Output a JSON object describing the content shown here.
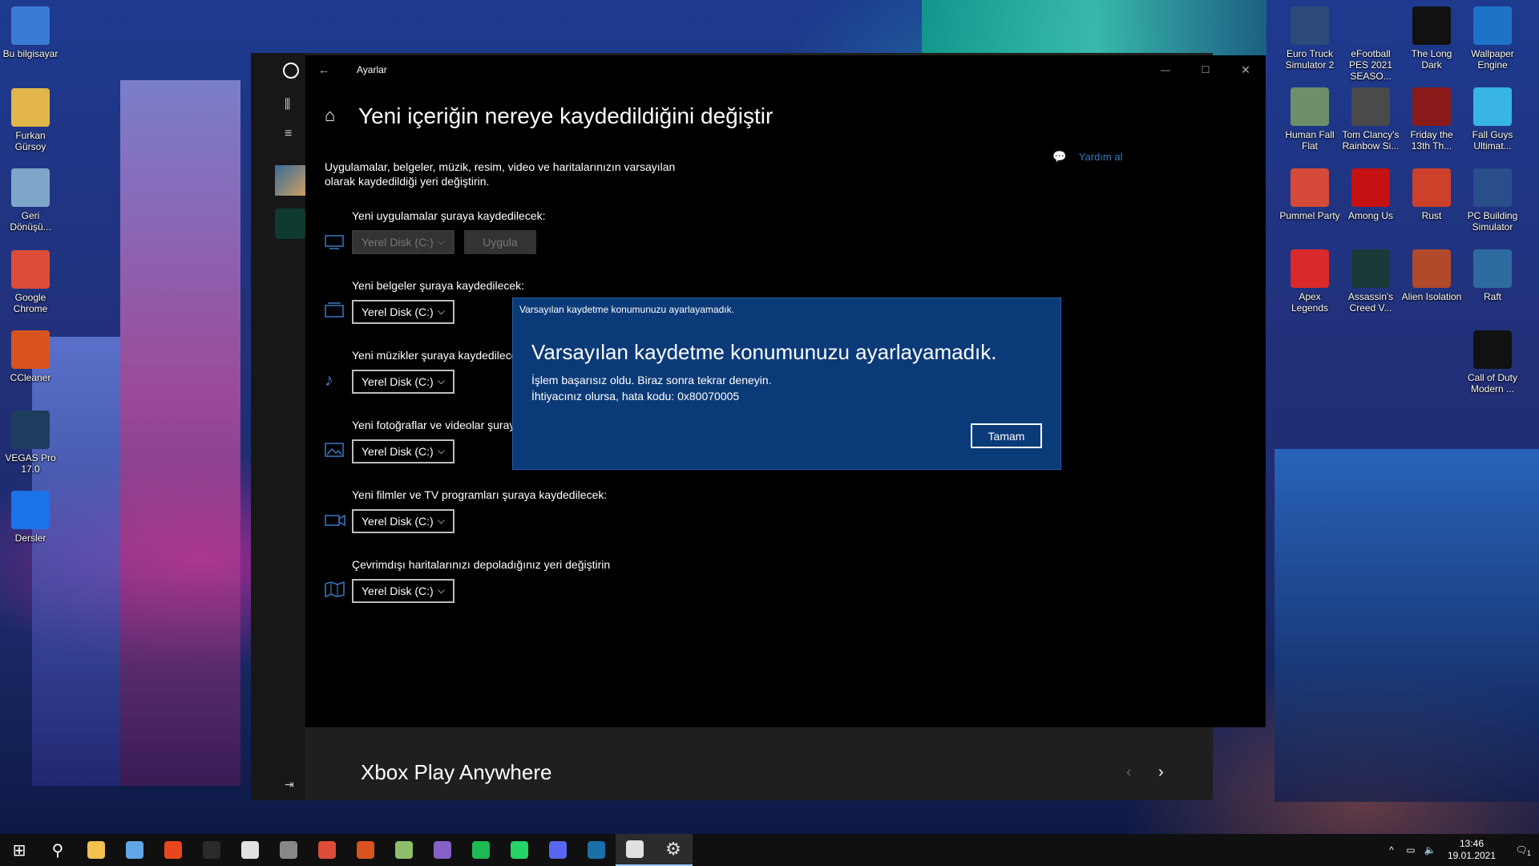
{
  "desktop": {
    "left_icons": [
      {
        "label": "Bu bilgisayar",
        "color": "#3a7bd5"
      },
      {
        "label": "Furkan Gürsoy",
        "color": "#e2b64a"
      },
      {
        "label": "Geri Dönüşü...",
        "color": "#7fa6c8"
      },
      {
        "label": "Google Chrome",
        "color": "#dd4b39"
      },
      {
        "label": "CCleaner",
        "color": "#d9531e"
      },
      {
        "label": "VEGAS Pro 17.0",
        "color": "#1d3d5e"
      },
      {
        "label": "Dersler",
        "color": "#1a73e8"
      }
    ],
    "right_icons": [
      {
        "label": "Euro Truck Simulator 2",
        "color": "#2b4a7a"
      },
      {
        "label": "eFootball PES 2021 SEASO...",
        "color": "#1e3c8a"
      },
      {
        "label": "The Long Dark",
        "color": "#111111"
      },
      {
        "label": "Wallpaper Engine",
        "color": "#1e73c8"
      },
      {
        "label": "Human Fall Flat",
        "color": "#6d8f6a"
      },
      {
        "label": "Tom Clancy's Rainbow Si...",
        "color": "#4a4a4a"
      },
      {
        "label": "Friday the 13th Th...",
        "color": "#8a1a1a"
      },
      {
        "label": "Fall Guys Ultimat...",
        "color": "#39b4e6"
      },
      {
        "label": "Pummel Party",
        "color": "#d64a3a"
      },
      {
        "label": "Among Us",
        "color": "#c51111"
      },
      {
        "label": "Rust",
        "color": "#cd412b"
      },
      {
        "label": "PC Building Simulator",
        "color": "#2a4e8a"
      },
      {
        "label": "Apex Legends",
        "color": "#da292a"
      },
      {
        "label": "Assassin's Creed V...",
        "color": "#1a3a3a"
      },
      {
        "label": "Alien Isolation",
        "color": "#b04a2a"
      },
      {
        "label": "Raft",
        "color": "#2d6aa0"
      },
      {
        "label": "Call of Duty Modern ...",
        "color": "#111111"
      }
    ]
  },
  "xbox_app": {
    "section_title": "Xbox Play Anywhere",
    "nav_icons": [
      "xbox-logo-icon",
      "library-icon",
      "menu-icon",
      "collapse-icon"
    ]
  },
  "settings": {
    "window_title": "Ayarlar",
    "page_title": "Yeni içeriğin nereye kaydedildiğini değiştir",
    "description": "Uygulamalar, belgeler, müzik, resim, video ve haritalarınızın varsayılan olarak kaydedildiği yeri değiştirin.",
    "help_label": "Yardım al",
    "apply_label": "Uygula",
    "sections": [
      {
        "label": "Yeni uygulamalar şuraya kaydedilecek:",
        "value": "Yerel Disk (C:)",
        "icon": "monitor-icon"
      },
      {
        "label": "Yeni belgeler şuraya kaydedilecek:",
        "value": "Yerel Disk (C:)",
        "icon": "documents-icon"
      },
      {
        "label": "Yeni müzikler şuraya kaydedilecek:",
        "value": "Yerel Disk (C:)",
        "icon": "music-note-icon"
      },
      {
        "label": "Yeni fotoğraflar ve videolar şuraya kaydedilecek:",
        "value": "Yerel Disk (C:)",
        "icon": "photo-icon"
      },
      {
        "label": "Yeni filmler ve TV programları şuraya kaydedilecek:",
        "value": "Yerel Disk (C:)",
        "icon": "video-camera-icon"
      },
      {
        "label": "Çevrimdışı haritalarınızı depoladığınız yeri değiştirin",
        "value": "Yerel Disk (C:)",
        "icon": "map-icon"
      }
    ]
  },
  "dialog": {
    "title": "Varsayılan kaydetme konumunuzu ayarlayamadık.",
    "heading": "Varsayılan kaydetme konumunuzu ayarlayamadık.",
    "line1": "İşlem başarısız oldu. Biraz sonra tekrar deneyin.",
    "line2": "İhtiyacınız olursa, hata kodu: 0x80070005",
    "ok_label": "Tamam"
  },
  "taskbar": {
    "apps": [
      {
        "name": "start-button",
        "color": "#ffffff"
      },
      {
        "name": "search-button",
        "color": "#ffffff"
      },
      {
        "name": "file-explorer",
        "color": "#f2c14e"
      },
      {
        "name": "this-pc",
        "color": "#5fa7e6"
      },
      {
        "name": "office",
        "color": "#e8461c"
      },
      {
        "name": "pes-game",
        "color": "#2a2a2a"
      },
      {
        "name": "app-round",
        "color": "#e0e0e0"
      },
      {
        "name": "app-dark",
        "color": "#888888"
      },
      {
        "name": "chrome",
        "color": "#dd4b39"
      },
      {
        "name": "ccleaner",
        "color": "#d9531e"
      },
      {
        "name": "notepad",
        "color": "#8fbf6a"
      },
      {
        "name": "visual-studio",
        "color": "#8661c5"
      },
      {
        "name": "spotify",
        "color": "#1db954"
      },
      {
        "name": "whatsapp",
        "color": "#25d366"
      },
      {
        "name": "discord",
        "color": "#5865f2"
      },
      {
        "name": "steam",
        "color": "#1b6fa8"
      },
      {
        "name": "xbox",
        "color": "#e0e0e0"
      },
      {
        "name": "settings",
        "color": "#e0e0e0"
      }
    ],
    "time": "13:46",
    "date": "19.01.2021",
    "notification_count": "1"
  }
}
